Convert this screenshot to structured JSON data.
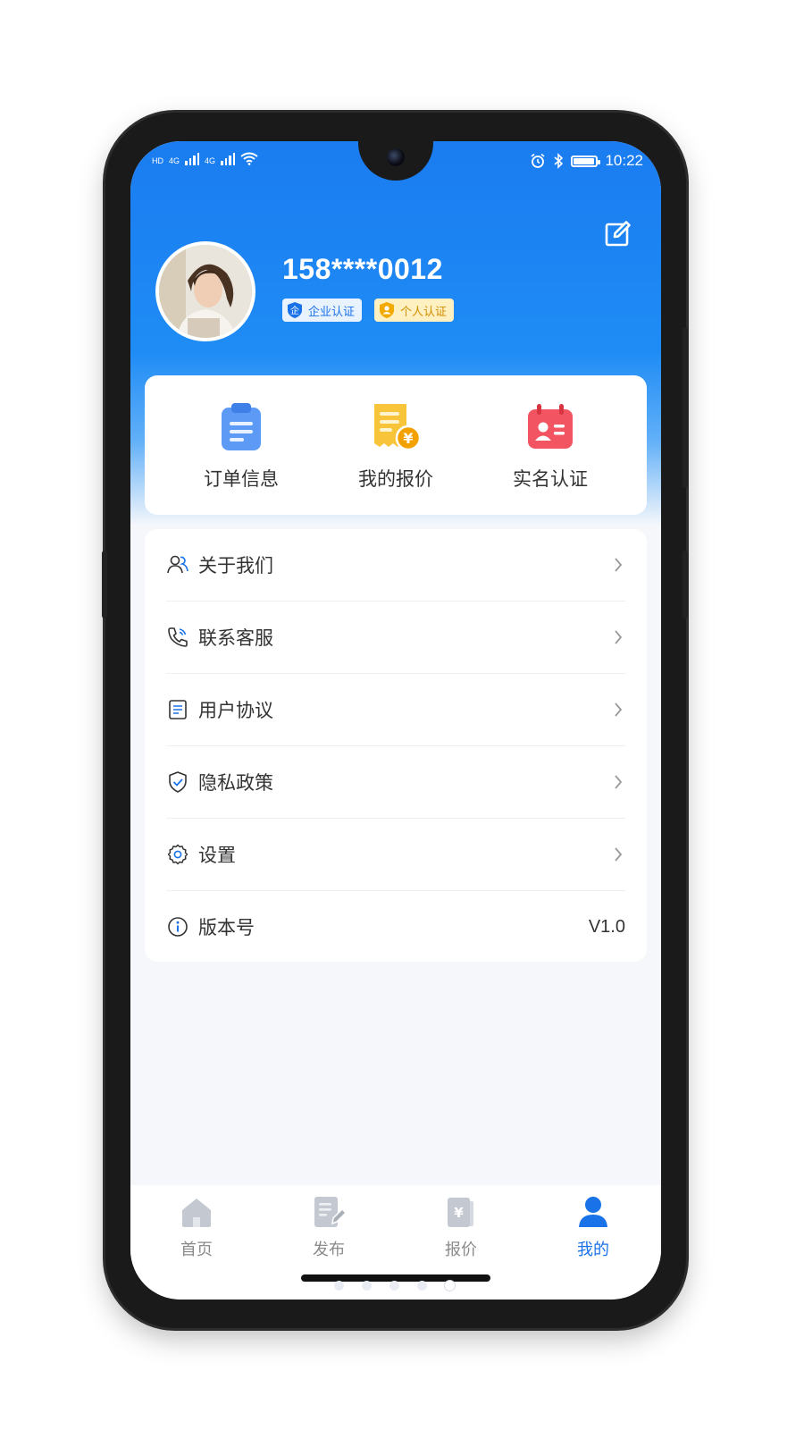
{
  "status_bar": {
    "time": "10:22",
    "network_left": "4G",
    "network_right": "4G",
    "hd_label": "HD"
  },
  "profile": {
    "phone": "158****0012",
    "badges": [
      {
        "label": "企业认证",
        "icon_text": "企",
        "icon": "enterprise-shield-icon",
        "color": "#1a72e8"
      },
      {
        "label": "个人认证",
        "icon": "person-shield-icon",
        "color": "#f2a900"
      }
    ]
  },
  "quick_actions": [
    {
      "label": "订单信息",
      "icon": "clipboard-icon",
      "color": "#4c8ff5"
    },
    {
      "label": "我的报价",
      "icon": "quote-receipt-icon",
      "color": "#f5b829",
      "icon_text": "¥"
    },
    {
      "label": "实名认证",
      "icon": "id-card-icon",
      "color": "#f04452"
    }
  ],
  "menu": [
    {
      "label": "关于我们",
      "icon": "users-icon",
      "arrow": true
    },
    {
      "label": "联系客服",
      "icon": "phone-icon",
      "arrow": true
    },
    {
      "label": "用户协议",
      "icon": "document-icon",
      "arrow": true
    },
    {
      "label": "隐私政策",
      "icon": "shield-check-icon",
      "arrow": true
    },
    {
      "label": "设置",
      "icon": "gear-icon",
      "arrow": true
    },
    {
      "label": "版本号",
      "icon": "info-icon",
      "arrow": false,
      "value": "V1.0"
    }
  ],
  "tabs": [
    {
      "label": "首页",
      "icon": "home-icon",
      "active": false
    },
    {
      "label": "发布",
      "icon": "publish-icon",
      "active": false
    },
    {
      "label": "报价",
      "icon": "quote-icon",
      "active": false,
      "icon_text": "¥"
    },
    {
      "label": "我的",
      "icon": "profile-icon",
      "active": true
    }
  ],
  "colors": {
    "primary": "#1a72e8",
    "header_blue": "#1f8cf5",
    "tab_inactive": "#8a8a8a"
  }
}
